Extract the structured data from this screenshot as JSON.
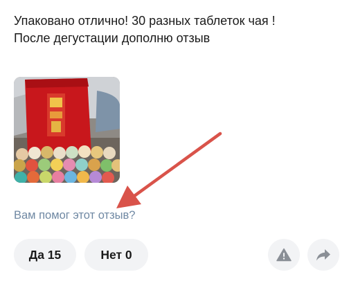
{
  "review": {
    "text_line1": "Упаковано отлично! 30 разных таблеток чая !",
    "text_line2": "После дегустации дополню отзыв"
  },
  "photo": {
    "icon": "review-photo-thumbnail"
  },
  "helpful": {
    "question": "Вам помог этот отзыв?",
    "yes_label": "Да 15",
    "no_label": "Нет 0"
  },
  "actions": {
    "report_icon": "warning-icon",
    "share_icon": "share-arrow-icon"
  },
  "colors": {
    "annotation_arrow": "#d9534a",
    "helpful_text": "#6f88a3",
    "button_bg": "#f2f3f5",
    "icon_gray": "#8a8f96"
  }
}
